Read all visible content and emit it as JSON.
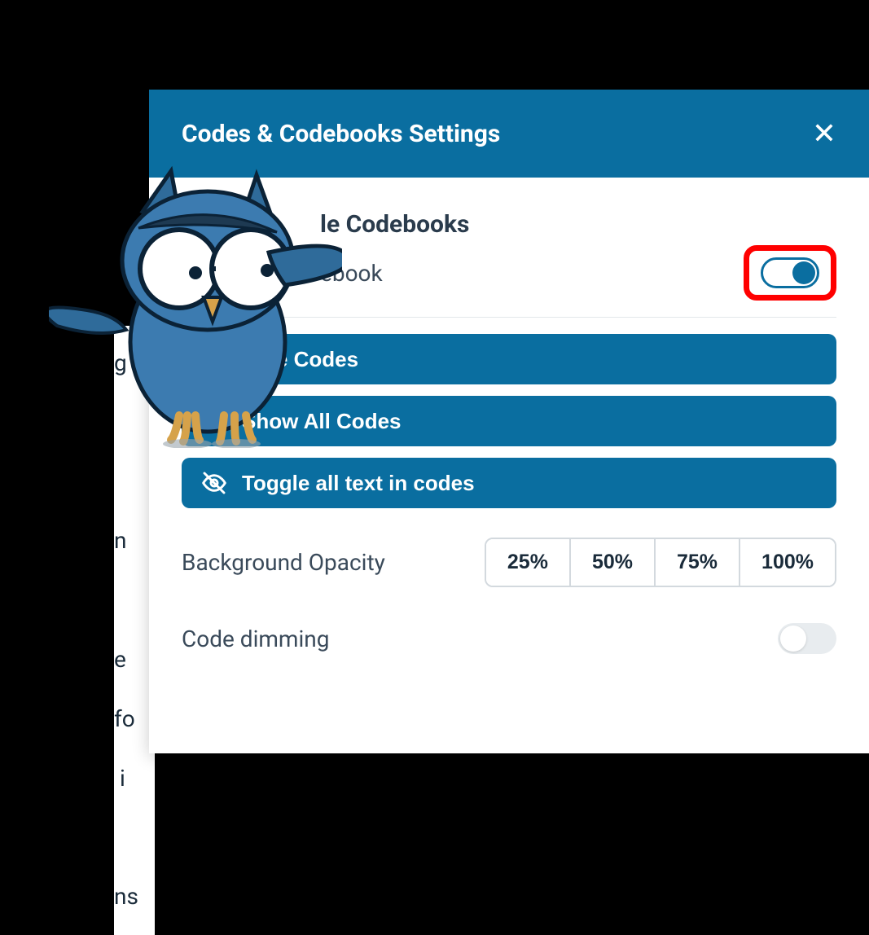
{
  "background": {
    "text_fragments": [
      "g",
      "n",
      "e",
      "fo",
      " i",
      "",
      "ns"
    ]
  },
  "modal": {
    "title": "Codes & Codebooks Settings",
    "section_title": "le Codebooks",
    "sub_label": "ebook",
    "toggle_codebook_on": true,
    "actions": [
      {
        "label": "Hide Codes",
        "icon": "eye-off-icon"
      },
      {
        "label": "Show All Codes",
        "icon": "box-icon"
      },
      {
        "label": "Toggle all text in codes",
        "icon": "eye-off-icon"
      }
    ],
    "opacity": {
      "label": "Background Opacity",
      "options": [
        "25%",
        "50%",
        "75%",
        "100%"
      ]
    },
    "dimming": {
      "label": "Code dimming",
      "on": false
    }
  }
}
